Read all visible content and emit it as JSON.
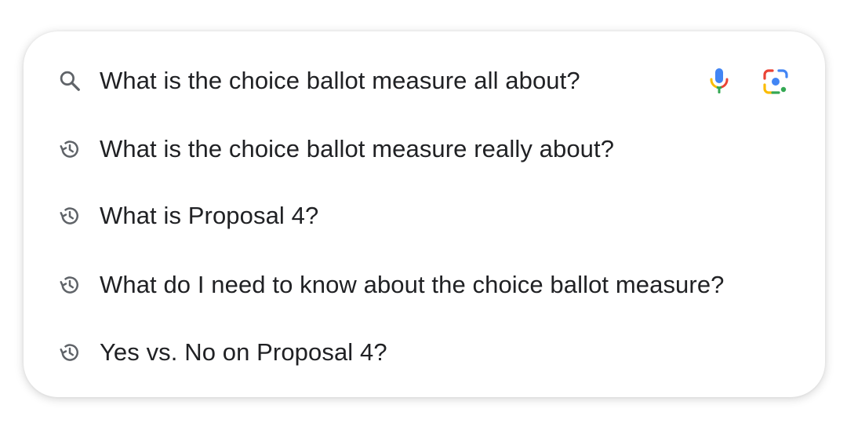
{
  "search": {
    "query": "What is the choice ballot measure all about?",
    "leading_icon": "search-icon",
    "voice_icon": "mic-icon",
    "lens_icon": "lens-icon"
  },
  "suggestions": [
    {
      "label": "What is the choice ballot measure really about?",
      "icon": "history-icon"
    },
    {
      "label": "What is Proposal 4?",
      "icon": "history-icon"
    },
    {
      "label": "What do I need to know about the choice ballot measure?",
      "icon": "history-icon"
    },
    {
      "label": "Yes vs. No on Proposal 4?",
      "icon": "history-icon"
    }
  ],
  "colors": {
    "text": "#202124",
    "icon_gray": "#5f6368",
    "google_blue": "#4285F4",
    "google_red": "#EA4335",
    "google_yellow": "#FBBC04",
    "google_green": "#34A853"
  }
}
